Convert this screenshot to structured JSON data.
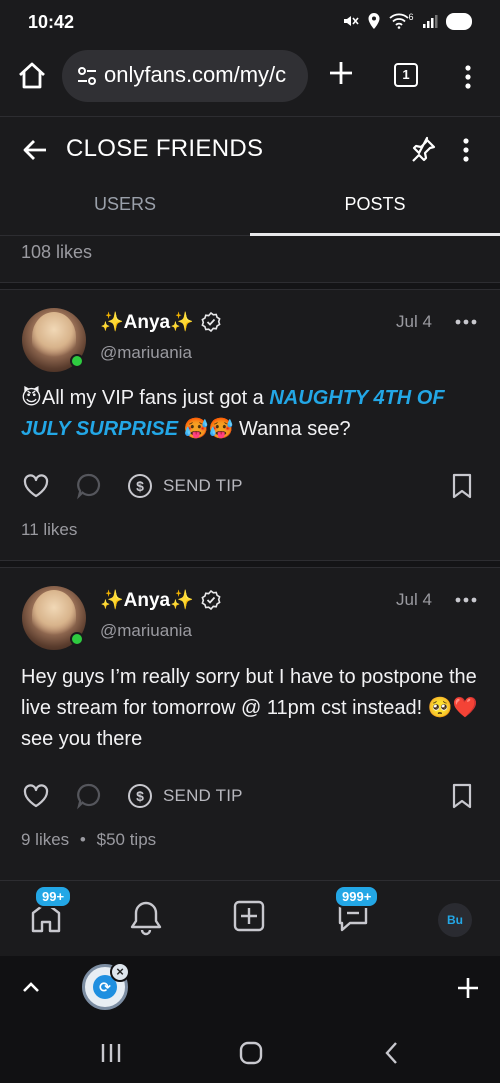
{
  "status_bar": {
    "time": "10:42",
    "signal_label": "6",
    "battery": "90"
  },
  "browser": {
    "url": "onlyfans.com/my/c",
    "tab_count": "1"
  },
  "header": {
    "title": "CLOSE FRIENDS"
  },
  "tabs": [
    {
      "label": "USERS"
    },
    {
      "label": "POSTS"
    }
  ],
  "feed": {
    "top_likes": "108 likes",
    "posts": [
      {
        "author": "✨Anya✨",
        "handle": "@mariuania",
        "date": "Jul 4",
        "text_prefix": "😈All my VIP fans just got a ",
        "text_highlight": "NAUGHTY 4TH OF JULY SURPRISE",
        "text_suffix": " 🥵🥵 Wanna see?",
        "tip_label": "SEND TIP",
        "likes": "11 likes"
      },
      {
        "author": "✨Anya✨",
        "handle": "@mariuania",
        "date": "Jul 4",
        "text": "Hey guys I’m really sorry but I have to postpone the live stream for tomorrow @ 11pm cst instead! 🥺❤️ see you there",
        "tip_label": "SEND TIP",
        "likes": "9 likes",
        "tips": "$50 tips"
      }
    ]
  },
  "app_nav": {
    "home_badge": "99+",
    "messages_badge": "999+",
    "avatar_initials": "Bu"
  },
  "colors": {
    "accent": "#23a7e6",
    "background": "#1b1b1d",
    "online": "#2ecc40"
  },
  "icons": [
    "home-icon",
    "tune-icon",
    "plus-icon",
    "tabs-icon",
    "more-vertical-icon",
    "arrow-left-icon",
    "pin-icon",
    "verified-icon",
    "more-horizontal-icon",
    "heart-icon",
    "comment-icon",
    "dollar-icon",
    "bookmark-icon",
    "bell-icon",
    "add-square-icon",
    "message-icon",
    "chevron-up-icon",
    "recent-apps-icon",
    "circle-home-icon",
    "back-chevron-icon"
  ]
}
